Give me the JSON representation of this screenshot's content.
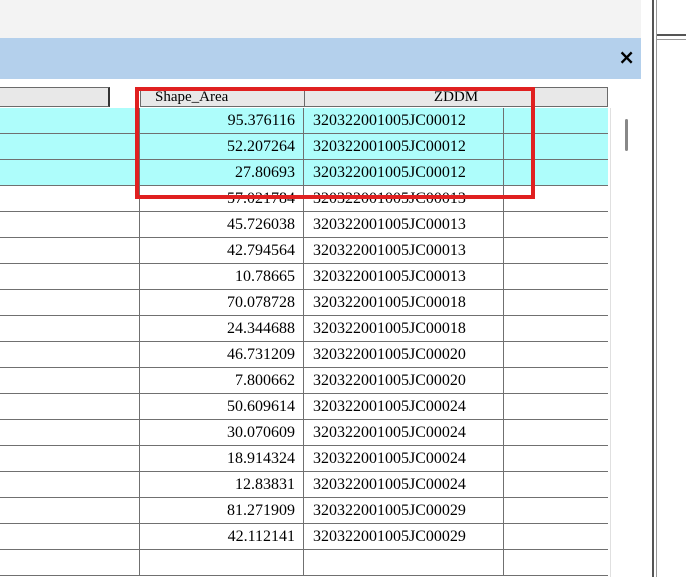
{
  "window": {
    "close_label": "×"
  },
  "table": {
    "columns": {
      "left": "",
      "shape_area": "Shape_Area",
      "zddm": "ZDDM"
    },
    "rows": [
      {
        "area": "95.376116",
        "zddm": "320322001005JC00012",
        "selected": true
      },
      {
        "area": "52.207264",
        "zddm": "320322001005JC00012",
        "selected": true
      },
      {
        "area": "27.80693",
        "zddm": "320322001005JC00012",
        "selected": true
      },
      {
        "area": "57.021784",
        "zddm": "320322001005JC00013",
        "selected": false
      },
      {
        "area": "45.726038",
        "zddm": "320322001005JC00013",
        "selected": false
      },
      {
        "area": "42.794564",
        "zddm": "320322001005JC00013",
        "selected": false
      },
      {
        "area": "10.78665",
        "zddm": "320322001005JC00013",
        "selected": false
      },
      {
        "area": "70.078728",
        "zddm": "320322001005JC00018",
        "selected": false
      },
      {
        "area": "24.344688",
        "zddm": "320322001005JC00018",
        "selected": false
      },
      {
        "area": "46.731209",
        "zddm": "320322001005JC00020",
        "selected": false
      },
      {
        "area": "7.800662",
        "zddm": "320322001005JC00020",
        "selected": false
      },
      {
        "area": "50.609614",
        "zddm": "320322001005JC00024",
        "selected": false
      },
      {
        "area": "30.070609",
        "zddm": "320322001005JC00024",
        "selected": false
      },
      {
        "area": "18.914324",
        "zddm": "320322001005JC00024",
        "selected": false
      },
      {
        "area": "12.83831",
        "zddm": "320322001005JC00024",
        "selected": false
      },
      {
        "area": "81.271909",
        "zddm": "320322001005JC00029",
        "selected": false
      },
      {
        "area": "42.112141",
        "zddm": "320322001005JC00029",
        "selected": false
      },
      {
        "area": "",
        "zddm": "",
        "selected": false
      }
    ]
  },
  "colors": {
    "selection": "#aefdfb",
    "highlight_box": "#e02020",
    "titlebar": "#b4d0ec"
  }
}
